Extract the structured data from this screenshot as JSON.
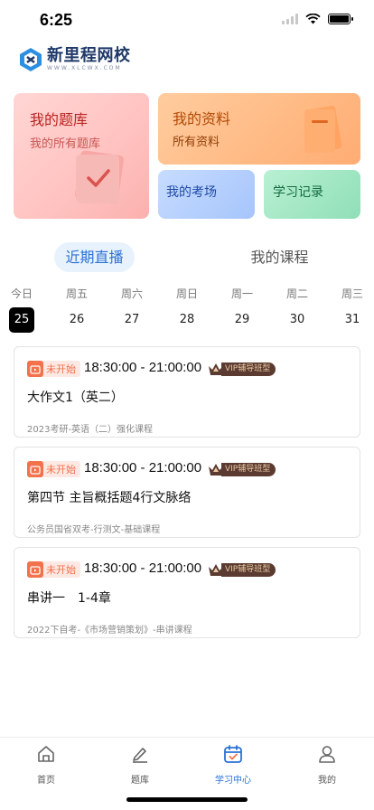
{
  "status_bar": {
    "time": "6:25"
  },
  "brand": {
    "name": "新里程网校",
    "subtitle": "WWW.XLCWX.COM",
    "logo_color": "#2d8fe0"
  },
  "cards": {
    "tiku": {
      "title": "我的题库",
      "subtitle": "我的所有题库"
    },
    "ziliao": {
      "title": "我的资料",
      "subtitle": "所有资料"
    },
    "kaochang": {
      "title": "我的考场"
    },
    "jilu": {
      "title": "学习记录"
    }
  },
  "tabs": [
    {
      "label": "近期直播",
      "active": true
    },
    {
      "label": "我的课程",
      "active": false
    }
  ],
  "week": [
    {
      "name": "今日",
      "date": "25",
      "selected": true
    },
    {
      "name": "周五",
      "date": "26"
    },
    {
      "name": "周六",
      "date": "27"
    },
    {
      "name": "周日",
      "date": "28"
    },
    {
      "name": "周一",
      "date": "29"
    },
    {
      "name": "周二",
      "date": "30"
    },
    {
      "name": "周三",
      "date": "31"
    }
  ],
  "schedule": [
    {
      "status": "未开始",
      "time": "18:30:00 - 21:00:00",
      "badge": "VIP辅导班型",
      "title": "大作文1（英二）",
      "course": "2023考研-英语（二）强化课程"
    },
    {
      "status": "未开始",
      "time": "18:30:00 - 21:00:00",
      "badge": "VIP辅导班型",
      "title": "第四节 主旨概括题4行文脉络",
      "course": "公务员国省双考-行测文-基础课程"
    },
    {
      "status": "未开始",
      "time": "18:30:00 - 21:00:00",
      "badge": "VIP辅导班型",
      "title": "串讲一　1-4章",
      "course": "2022下自考-《市场营销策划》-串讲课程"
    }
  ],
  "tabbar": [
    {
      "label": "首页",
      "icon": "home-icon",
      "active": false
    },
    {
      "label": "题库",
      "icon": "edit-icon",
      "active": false
    },
    {
      "label": "学习中心",
      "icon": "study-center-icon",
      "active": true
    },
    {
      "label": "我的",
      "icon": "user-icon",
      "active": false
    }
  ],
  "colors": {
    "accent": "#2a72d6",
    "status_tag": "#f2724b",
    "vip_bg": "#5b3b31"
  }
}
